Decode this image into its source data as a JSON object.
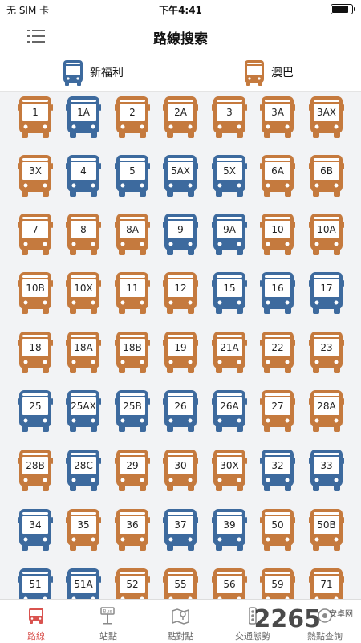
{
  "status": {
    "carrier": "无 SIM 卡",
    "time": "下午4:41",
    "battery_level": 0.9
  },
  "navbar": {
    "title": "路線搜索",
    "menu_icon": "list-menu-icon"
  },
  "legend": [
    {
      "label": "新福利",
      "color": "#3d6a9e"
    },
    {
      "label": "澳巴",
      "color": "#c57a3e"
    }
  ],
  "colors": {
    "blue": "#3d6a9e",
    "orange": "#c57a3e",
    "active": "#d9534f"
  },
  "routes": [
    [
      {
        "n": "1",
        "c": "o"
      },
      {
        "n": "1A",
        "c": "b"
      },
      {
        "n": "2",
        "c": "o"
      },
      {
        "n": "2A",
        "c": "o"
      },
      {
        "n": "3",
        "c": "o"
      },
      {
        "n": "3A",
        "c": "o"
      },
      {
        "n": "3AX",
        "c": "o"
      }
    ],
    [
      {
        "n": "3X",
        "c": "o"
      },
      {
        "n": "4",
        "c": "b"
      },
      {
        "n": "5",
        "c": "b"
      },
      {
        "n": "5AX",
        "c": "b"
      },
      {
        "n": "5X",
        "c": "b"
      },
      {
        "n": "6A",
        "c": "o"
      },
      {
        "n": "6B",
        "c": "o"
      }
    ],
    [
      {
        "n": "7",
        "c": "o"
      },
      {
        "n": "8",
        "c": "o"
      },
      {
        "n": "8A",
        "c": "o"
      },
      {
        "n": "9",
        "c": "b"
      },
      {
        "n": "9A",
        "c": "b"
      },
      {
        "n": "10",
        "c": "o"
      },
      {
        "n": "10A",
        "c": "o"
      }
    ],
    [
      {
        "n": "10B",
        "c": "o"
      },
      {
        "n": "10X",
        "c": "o"
      },
      {
        "n": "11",
        "c": "o"
      },
      {
        "n": "12",
        "c": "o"
      },
      {
        "n": "15",
        "c": "b"
      },
      {
        "n": "16",
        "c": "b"
      },
      {
        "n": "17",
        "c": "b"
      }
    ],
    [
      {
        "n": "18",
        "c": "o"
      },
      {
        "n": "18A",
        "c": "o"
      },
      {
        "n": "18B",
        "c": "o"
      },
      {
        "n": "19",
        "c": "o"
      },
      {
        "n": "21A",
        "c": "o"
      },
      {
        "n": "22",
        "c": "o"
      },
      {
        "n": "23",
        "c": "o"
      }
    ],
    [
      {
        "n": "25",
        "c": "b"
      },
      {
        "n": "25AX",
        "c": "b"
      },
      {
        "n": "25B",
        "c": "b"
      },
      {
        "n": "26",
        "c": "b"
      },
      {
        "n": "26A",
        "c": "b"
      },
      {
        "n": "27",
        "c": "o"
      },
      {
        "n": "28A",
        "c": "o"
      }
    ],
    [
      {
        "n": "28B",
        "c": "o"
      },
      {
        "n": "28C",
        "c": "b"
      },
      {
        "n": "29",
        "c": "o"
      },
      {
        "n": "30",
        "c": "o"
      },
      {
        "n": "30X",
        "c": "o"
      },
      {
        "n": "32",
        "c": "b"
      },
      {
        "n": "33",
        "c": "b"
      }
    ],
    [
      {
        "n": "34",
        "c": "b"
      },
      {
        "n": "35",
        "c": "o"
      },
      {
        "n": "36",
        "c": "o"
      },
      {
        "n": "37",
        "c": "b"
      },
      {
        "n": "39",
        "c": "b"
      },
      {
        "n": "50",
        "c": "o"
      },
      {
        "n": "50B",
        "c": "o"
      }
    ],
    [
      {
        "n": "51",
        "c": "b"
      },
      {
        "n": "51A",
        "c": "b"
      },
      {
        "n": "52",
        "c": "o"
      },
      {
        "n": "55",
        "c": "o"
      },
      {
        "n": "56",
        "c": "o"
      },
      {
        "n": "59",
        "c": "o"
      },
      {
        "n": "71",
        "c": "o"
      }
    ]
  ],
  "tabs": [
    {
      "label": "路線",
      "icon": "bus-icon",
      "active": true
    },
    {
      "label": "站點",
      "icon": "bus-stop-icon",
      "active": false
    },
    {
      "label": "點對點",
      "icon": "map-route-icon",
      "active": false
    },
    {
      "label": "交通態勢",
      "icon": "traffic-icon",
      "active": false
    },
    {
      "label": "熱點查詢",
      "icon": "hotspot-icon",
      "active": false
    }
  ],
  "watermark": {
    "big": "2265",
    "small": "安卓网"
  }
}
